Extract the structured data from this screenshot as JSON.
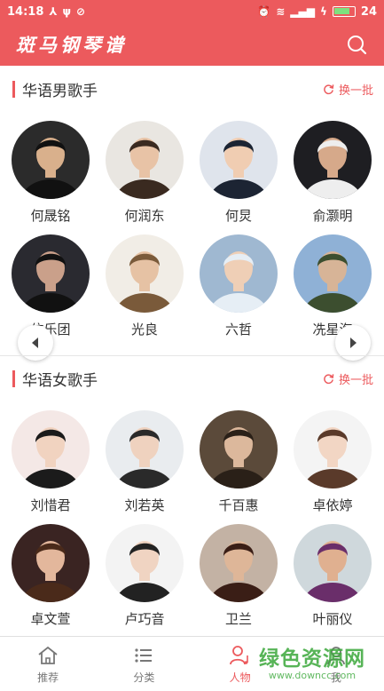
{
  "status": {
    "time": "14:18",
    "battery": "24"
  },
  "app": {
    "title": "斑马钢琴谱"
  },
  "male": {
    "title": "华语男歌手",
    "refresh": "换一批",
    "singers": [
      "何晟铭",
      "何润东",
      "何炅",
      "俞灏明",
      "信乐团",
      "光良",
      "六哲",
      "冼星海"
    ]
  },
  "female": {
    "title": "华语女歌手",
    "refresh": "换一批",
    "singers": [
      "刘惜君",
      "刘若英",
      "千百惠",
      "卓依婷",
      "卓文萱",
      "卢巧音",
      "卫兰",
      "叶丽仪"
    ]
  },
  "tabs": [
    {
      "label": "推荐",
      "icon": "home-icon"
    },
    {
      "label": "分类",
      "icon": "list-icon"
    },
    {
      "label": "人物",
      "icon": "person-music-icon"
    },
    {
      "label": "我",
      "icon": "user-icon"
    }
  ],
  "watermark": {
    "main": "绿色资源网",
    "sub": "www.downcc.com"
  },
  "colors": {
    "brand": "#ec5a5d",
    "watermark": "#3aa83a"
  }
}
